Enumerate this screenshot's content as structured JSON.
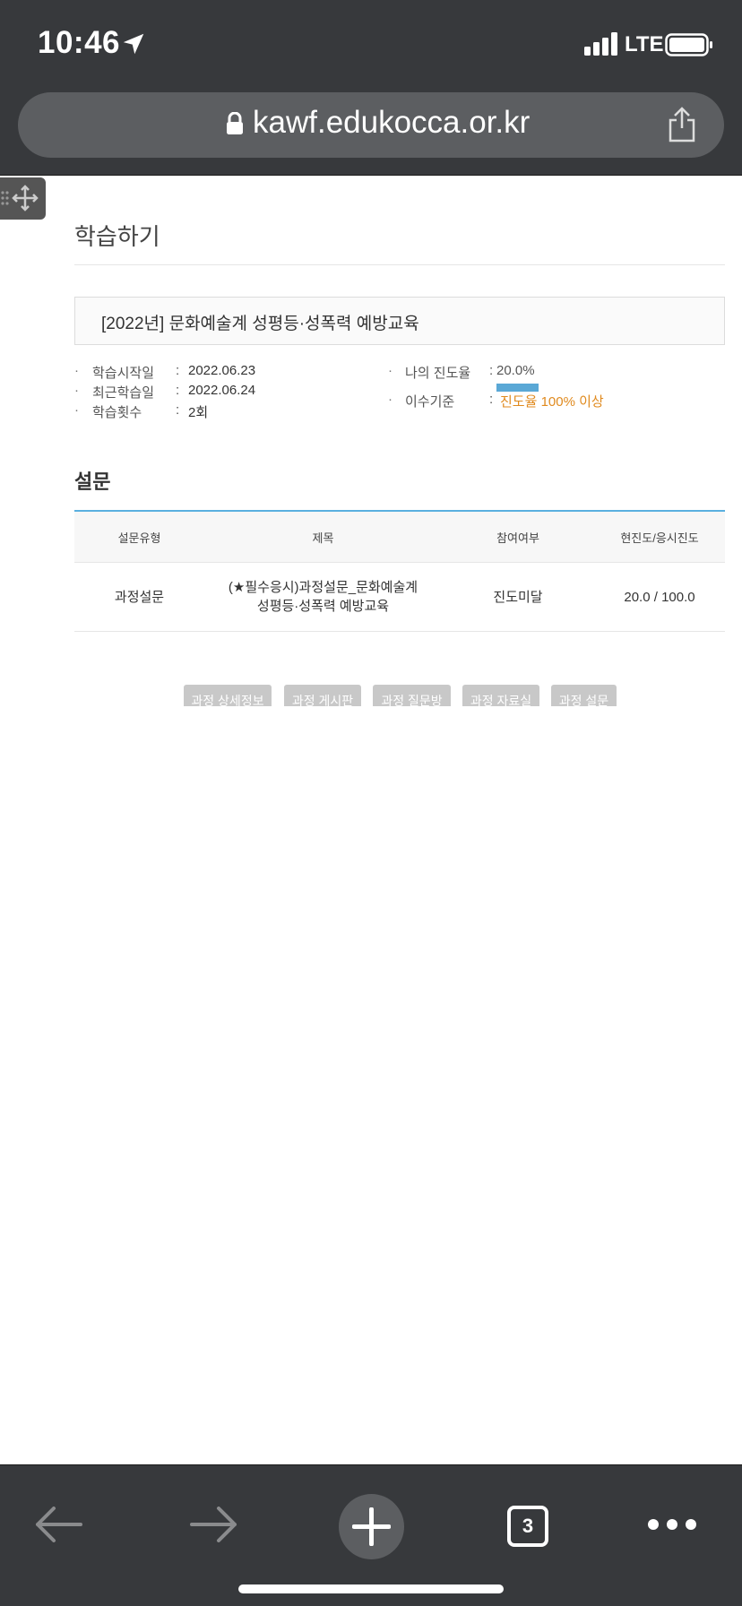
{
  "status_bar": {
    "time": "10:46",
    "network": "LTE",
    "icons": [
      "location-arrow-icon",
      "signal-icon",
      "battery-icon"
    ]
  },
  "browser": {
    "url": "kawf.edukocca.or.kr",
    "open_tabs": "3",
    "icons": [
      "lock-icon",
      "share-icon",
      "back-icon",
      "forward-icon",
      "new-tab-icon",
      "more-icon"
    ]
  },
  "page": {
    "title": "학습하기",
    "course_title": "[2022년] 문화예술계 성평등·성폭력 예방교육",
    "info": {
      "start_label": "학습시작일",
      "start_value": "2022.06.23",
      "recent_label": "최근학습일",
      "recent_value": "2022.06.24",
      "count_label": "학습횟수",
      "count_value": "2회",
      "progress_label": "나의 진도율",
      "progress_value": "20.0%",
      "progress_fraction": 0.2,
      "criteria_label": "이수기준",
      "criteria_value": "진도율 100% 이상",
      "bullet": "·",
      "colon": ":"
    },
    "survey": {
      "section_title": "설문",
      "headers": [
        "설문유형",
        "제목",
        "참여여부",
        "현진도/응시진도"
      ],
      "rows": [
        {
          "type": "과정설문",
          "title_line1": "(★필수응시)과정설문_문화예술계",
          "title_line2": "성평등·성폭력 예방교육",
          "status": "진도미달",
          "progress": "20.0 / 100.0"
        }
      ]
    },
    "buttons": [
      "과정 상세정보",
      "과정 게시판",
      "과정 질문방",
      "과정 자료실",
      "과정 설문"
    ]
  },
  "colors": {
    "accent_blue": "#5ab0e0",
    "progress_fill": "#5aa8d6",
    "criteria_orange": "#e08a1e",
    "chrome_dark": "#37393c"
  }
}
